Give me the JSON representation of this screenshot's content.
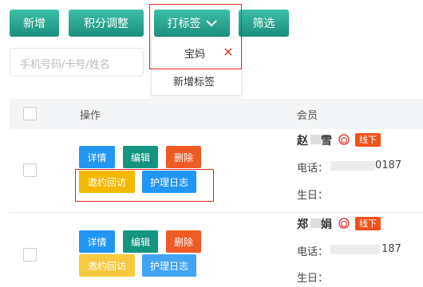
{
  "toolbar": {
    "add_label": "新增",
    "points_label": "积分调整",
    "tag_label": "打标签",
    "filter_label": "筛选"
  },
  "search": {
    "placeholder": "手机号码/卡号/姓名"
  },
  "tag_menu": {
    "items": [
      {
        "label": "宝妈"
      }
    ],
    "add_label": "新增标签"
  },
  "table": {
    "headers": {
      "action": "操作",
      "member": "会员"
    },
    "action_labels": {
      "detail": "详情",
      "edit": "编辑",
      "delete": "删除",
      "invite": "邀约回访",
      "care_log": "护理日志"
    },
    "rows": [
      {
        "name_a": "赵",
        "name_b": "雪",
        "tag": "线下",
        "phone_label": "电话：",
        "phone_tail": "0187",
        "birthday_label": "生日："
      },
      {
        "name_a": "郑",
        "name_b": "娟",
        "tag": "线下",
        "phone_label": "电话：",
        "phone_tail": "187",
        "birthday_label": "生日："
      }
    ]
  },
  "colors": {
    "accent_teal": "#1c8f7c",
    "highlight_red": "#e0261f",
    "blue": "#2196f3",
    "red": "#f05a24",
    "yellow": "#f5b800"
  }
}
